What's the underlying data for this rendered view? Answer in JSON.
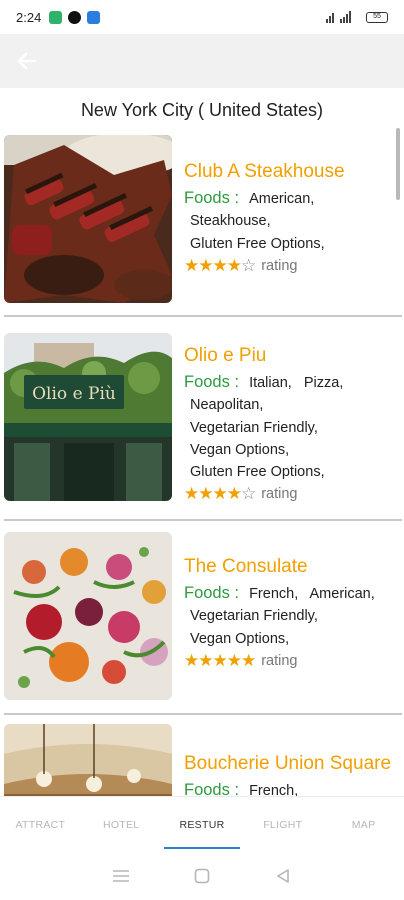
{
  "status_bar": {
    "time": "2:24",
    "battery": "55",
    "apps": [
      {
        "icon": "chat-app-icon",
        "color": "#2fb36b"
      },
      {
        "icon": "circle-a-app-icon",
        "color": "#111111"
      },
      {
        "icon": "photos-app-icon",
        "color": "#2b7de0"
      }
    ]
  },
  "header": {
    "back_icon": "back-arrow-icon"
  },
  "page_title": "New York City ( United States)",
  "foods_label": "Foods :",
  "rating_word": "rating",
  "restaurants": [
    {
      "name": "Club A Steakhouse",
      "foods": [
        "American,",
        "Steakhouse,",
        "Gluten Free Options,"
      ],
      "stars": 4,
      "image": "steak-photo"
    },
    {
      "name": "Olio e Piu",
      "foods": [
        "Italian,   Pizza,",
        "Neapolitan,",
        "Vegetarian Friendly,",
        "Vegan Options,",
        "Gluten Free Options,"
      ],
      "stars": 4,
      "image": "olio-storefront-photo",
      "sign_text": "Olio e Più"
    },
    {
      "name": "The Consulate",
      "foods": [
        "French,   American,",
        "Vegetarian Friendly,",
        "Vegan Options,"
      ],
      "stars": 5,
      "image": "consulate-dish-photo"
    },
    {
      "name": "Boucherie Union Square",
      "foods": [
        "French,"
      ],
      "stars": 0,
      "image": "boucherie-interior-photo"
    }
  ],
  "tabs": [
    {
      "label": "ATTRACT",
      "active": false
    },
    {
      "label": "HOTEL",
      "active": false
    },
    {
      "label": "RESTUR",
      "active": true
    },
    {
      "label": "FLIGHT",
      "active": false
    },
    {
      "label": "MAP",
      "active": false
    }
  ],
  "system_nav": [
    "menu-icon",
    "home-square-icon",
    "back-triangle-icon"
  ],
  "colors": {
    "accent_orange": "#f0a000",
    "foods_green": "#2e9a40",
    "tab_indicator": "#2f7fd8"
  }
}
